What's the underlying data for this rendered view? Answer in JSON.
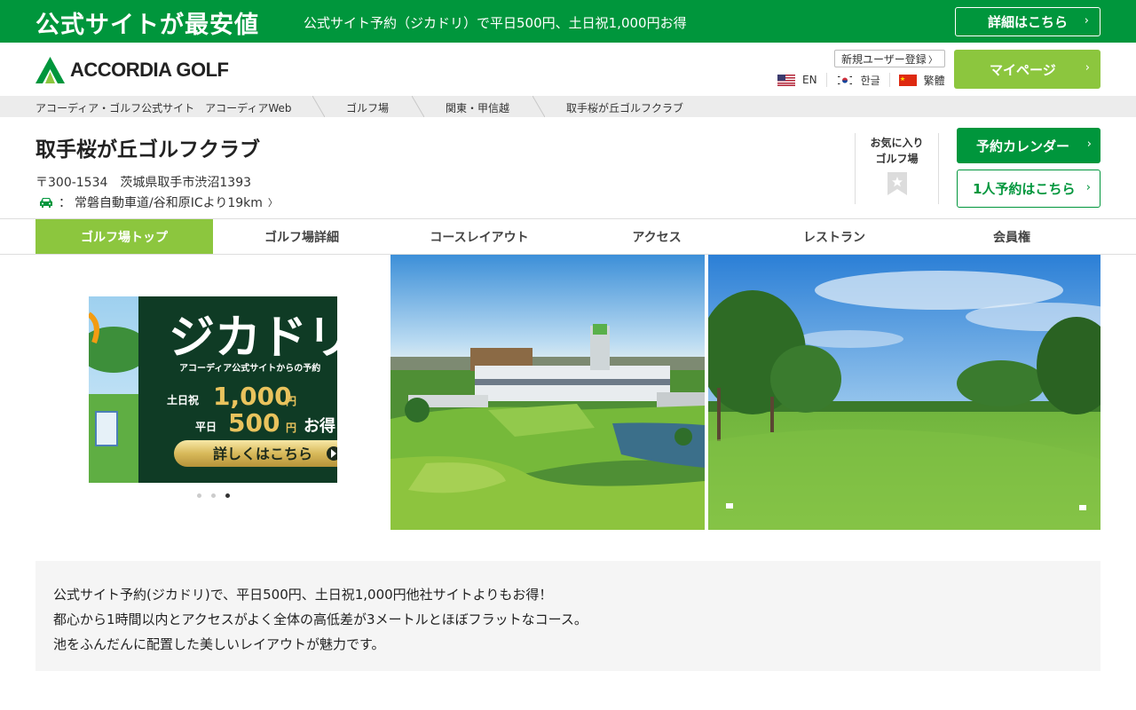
{
  "promo": {
    "title": "公式サイトが最安値",
    "text": "公式サイト予約（ジカドリ）で平日500円、土日祝1,000円お得",
    "button": "詳細はこちら"
  },
  "header": {
    "logo_text": "ACCORDIA GOLF",
    "register": "新規ユーザー登録",
    "mypage": "マイページ",
    "languages": [
      {
        "label": "EN",
        "flag": "us-flag"
      },
      {
        "label": "한글",
        "flag": "kr-flag"
      },
      {
        "label": "繁體",
        "flag": "cn-flag"
      }
    ]
  },
  "breadcrumb": [
    "アコーディア・ゴルフ公式サイト　アコーディアWeb",
    "ゴルフ場",
    "関東・甲信越",
    "取手桜が丘ゴルフクラブ"
  ],
  "course": {
    "name": "取手桜が丘ゴルフクラブ",
    "address": "〒300-1534　茨城県取手市渋沼1393",
    "access_prefix": "：",
    "access": "常磐自動車道/谷和原ICより19km",
    "favorite_line1": "お気に入り",
    "favorite_line2": "ゴルフ場",
    "calendar_button": "予約カレンダー",
    "solo_button": "1人予約はこちら"
  },
  "tabs": [
    "ゴルフ場トップ",
    "ゴルフ場詳細",
    "コースレイアウト",
    "アクセス",
    "レストラン",
    "会員権"
  ],
  "banner": {
    "headline": "ジカドリ",
    "subline": "アコーディア公式サイトからの予約",
    "weekend_label": "土日祝",
    "weekend_value": "1,000",
    "yen": "円",
    "weekday_label": "平日",
    "weekday_value": "500",
    "otoku": "お得",
    "button": "詳しくはこちら",
    "slides": 3,
    "active_slide": 3
  },
  "description": [
    "公式サイト予約(ジカドリ)で、平日500円、土日祝1,000円他社サイトよりもお得！",
    "都心から1時間以内とアクセスがよく全体の高低差が3メートルとほぼフラットなコース。",
    "池をふんだんに配置した美しいレイアウトが魅力です。"
  ],
  "colors": {
    "brand_green": "#00963c",
    "accent_lime": "#8cc63e"
  }
}
